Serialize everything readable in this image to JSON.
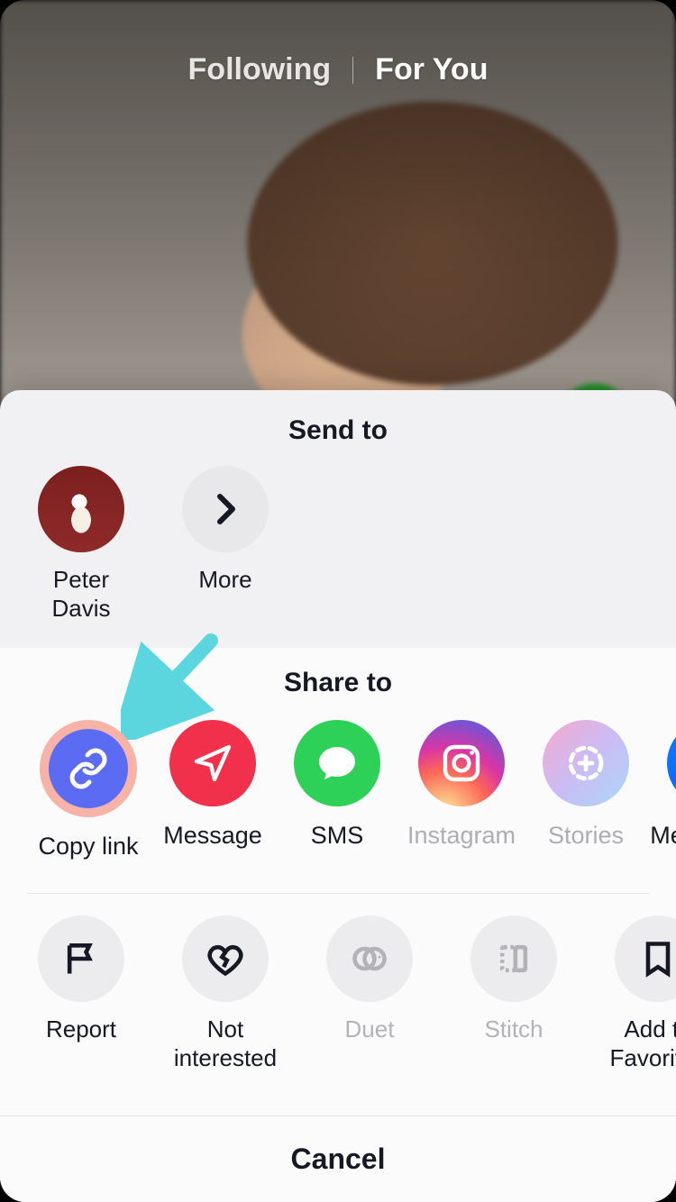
{
  "top_tabs": {
    "following": "Following",
    "for_you": "For You"
  },
  "share_sheet": {
    "send_to_title": "Send to",
    "send_to": [
      {
        "label": "Peter Davis"
      },
      {
        "label": "More"
      }
    ],
    "share_to_title": "Share to",
    "share_to": [
      {
        "label": "Copy link",
        "highlighted": true
      },
      {
        "label": "Message"
      },
      {
        "label": "SMS"
      },
      {
        "label": "Instagram"
      },
      {
        "label": "Stories"
      },
      {
        "label": "Messenger"
      }
    ],
    "actions": [
      {
        "label": "Report"
      },
      {
        "label": "Not interested"
      },
      {
        "label": "Duet",
        "disabled": true
      },
      {
        "label": "Stitch",
        "disabled": true
      },
      {
        "label": "Add to Favorites"
      }
    ],
    "cancel": "Cancel"
  },
  "annotation": {
    "arrow_color": "#5bd6df"
  }
}
